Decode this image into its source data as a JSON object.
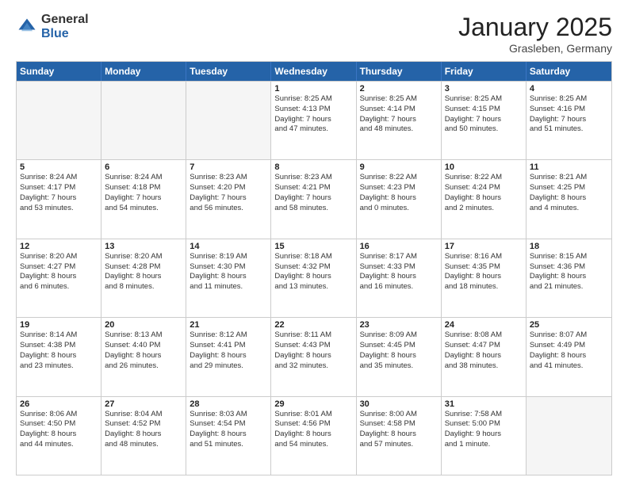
{
  "logo": {
    "general": "General",
    "blue": "Blue"
  },
  "title": "January 2025",
  "location": "Grasleben, Germany",
  "days": [
    "Sunday",
    "Monday",
    "Tuesday",
    "Wednesday",
    "Thursday",
    "Friday",
    "Saturday"
  ],
  "weeks": [
    [
      {
        "day": "",
        "content": "",
        "empty": true
      },
      {
        "day": "",
        "content": "",
        "empty": true
      },
      {
        "day": "",
        "content": "",
        "empty": true
      },
      {
        "day": "1",
        "content": "Sunrise: 8:25 AM\nSunset: 4:13 PM\nDaylight: 7 hours\nand 47 minutes.",
        "empty": false
      },
      {
        "day": "2",
        "content": "Sunrise: 8:25 AM\nSunset: 4:14 PM\nDaylight: 7 hours\nand 48 minutes.",
        "empty": false
      },
      {
        "day": "3",
        "content": "Sunrise: 8:25 AM\nSunset: 4:15 PM\nDaylight: 7 hours\nand 50 minutes.",
        "empty": false
      },
      {
        "day": "4",
        "content": "Sunrise: 8:25 AM\nSunset: 4:16 PM\nDaylight: 7 hours\nand 51 minutes.",
        "empty": false
      }
    ],
    [
      {
        "day": "5",
        "content": "Sunrise: 8:24 AM\nSunset: 4:17 PM\nDaylight: 7 hours\nand 53 minutes.",
        "empty": false
      },
      {
        "day": "6",
        "content": "Sunrise: 8:24 AM\nSunset: 4:18 PM\nDaylight: 7 hours\nand 54 minutes.",
        "empty": false
      },
      {
        "day": "7",
        "content": "Sunrise: 8:23 AM\nSunset: 4:20 PM\nDaylight: 7 hours\nand 56 minutes.",
        "empty": false
      },
      {
        "day": "8",
        "content": "Sunrise: 8:23 AM\nSunset: 4:21 PM\nDaylight: 7 hours\nand 58 minutes.",
        "empty": false
      },
      {
        "day": "9",
        "content": "Sunrise: 8:22 AM\nSunset: 4:23 PM\nDaylight: 8 hours\nand 0 minutes.",
        "empty": false
      },
      {
        "day": "10",
        "content": "Sunrise: 8:22 AM\nSunset: 4:24 PM\nDaylight: 8 hours\nand 2 minutes.",
        "empty": false
      },
      {
        "day": "11",
        "content": "Sunrise: 8:21 AM\nSunset: 4:25 PM\nDaylight: 8 hours\nand 4 minutes.",
        "empty": false
      }
    ],
    [
      {
        "day": "12",
        "content": "Sunrise: 8:20 AM\nSunset: 4:27 PM\nDaylight: 8 hours\nand 6 minutes.",
        "empty": false
      },
      {
        "day": "13",
        "content": "Sunrise: 8:20 AM\nSunset: 4:28 PM\nDaylight: 8 hours\nand 8 minutes.",
        "empty": false
      },
      {
        "day": "14",
        "content": "Sunrise: 8:19 AM\nSunset: 4:30 PM\nDaylight: 8 hours\nand 11 minutes.",
        "empty": false
      },
      {
        "day": "15",
        "content": "Sunrise: 8:18 AM\nSunset: 4:32 PM\nDaylight: 8 hours\nand 13 minutes.",
        "empty": false
      },
      {
        "day": "16",
        "content": "Sunrise: 8:17 AM\nSunset: 4:33 PM\nDaylight: 8 hours\nand 16 minutes.",
        "empty": false
      },
      {
        "day": "17",
        "content": "Sunrise: 8:16 AM\nSunset: 4:35 PM\nDaylight: 8 hours\nand 18 minutes.",
        "empty": false
      },
      {
        "day": "18",
        "content": "Sunrise: 8:15 AM\nSunset: 4:36 PM\nDaylight: 8 hours\nand 21 minutes.",
        "empty": false
      }
    ],
    [
      {
        "day": "19",
        "content": "Sunrise: 8:14 AM\nSunset: 4:38 PM\nDaylight: 8 hours\nand 23 minutes.",
        "empty": false
      },
      {
        "day": "20",
        "content": "Sunrise: 8:13 AM\nSunset: 4:40 PM\nDaylight: 8 hours\nand 26 minutes.",
        "empty": false
      },
      {
        "day": "21",
        "content": "Sunrise: 8:12 AM\nSunset: 4:41 PM\nDaylight: 8 hours\nand 29 minutes.",
        "empty": false
      },
      {
        "day": "22",
        "content": "Sunrise: 8:11 AM\nSunset: 4:43 PM\nDaylight: 8 hours\nand 32 minutes.",
        "empty": false
      },
      {
        "day": "23",
        "content": "Sunrise: 8:09 AM\nSunset: 4:45 PM\nDaylight: 8 hours\nand 35 minutes.",
        "empty": false
      },
      {
        "day": "24",
        "content": "Sunrise: 8:08 AM\nSunset: 4:47 PM\nDaylight: 8 hours\nand 38 minutes.",
        "empty": false
      },
      {
        "day": "25",
        "content": "Sunrise: 8:07 AM\nSunset: 4:49 PM\nDaylight: 8 hours\nand 41 minutes.",
        "empty": false
      }
    ],
    [
      {
        "day": "26",
        "content": "Sunrise: 8:06 AM\nSunset: 4:50 PM\nDaylight: 8 hours\nand 44 minutes.",
        "empty": false
      },
      {
        "day": "27",
        "content": "Sunrise: 8:04 AM\nSunset: 4:52 PM\nDaylight: 8 hours\nand 48 minutes.",
        "empty": false
      },
      {
        "day": "28",
        "content": "Sunrise: 8:03 AM\nSunset: 4:54 PM\nDaylight: 8 hours\nand 51 minutes.",
        "empty": false
      },
      {
        "day": "29",
        "content": "Sunrise: 8:01 AM\nSunset: 4:56 PM\nDaylight: 8 hours\nand 54 minutes.",
        "empty": false
      },
      {
        "day": "30",
        "content": "Sunrise: 8:00 AM\nSunset: 4:58 PM\nDaylight: 8 hours\nand 57 minutes.",
        "empty": false
      },
      {
        "day": "31",
        "content": "Sunrise: 7:58 AM\nSunset: 5:00 PM\nDaylight: 9 hours\nand 1 minute.",
        "empty": false
      },
      {
        "day": "",
        "content": "",
        "empty": true
      }
    ]
  ]
}
